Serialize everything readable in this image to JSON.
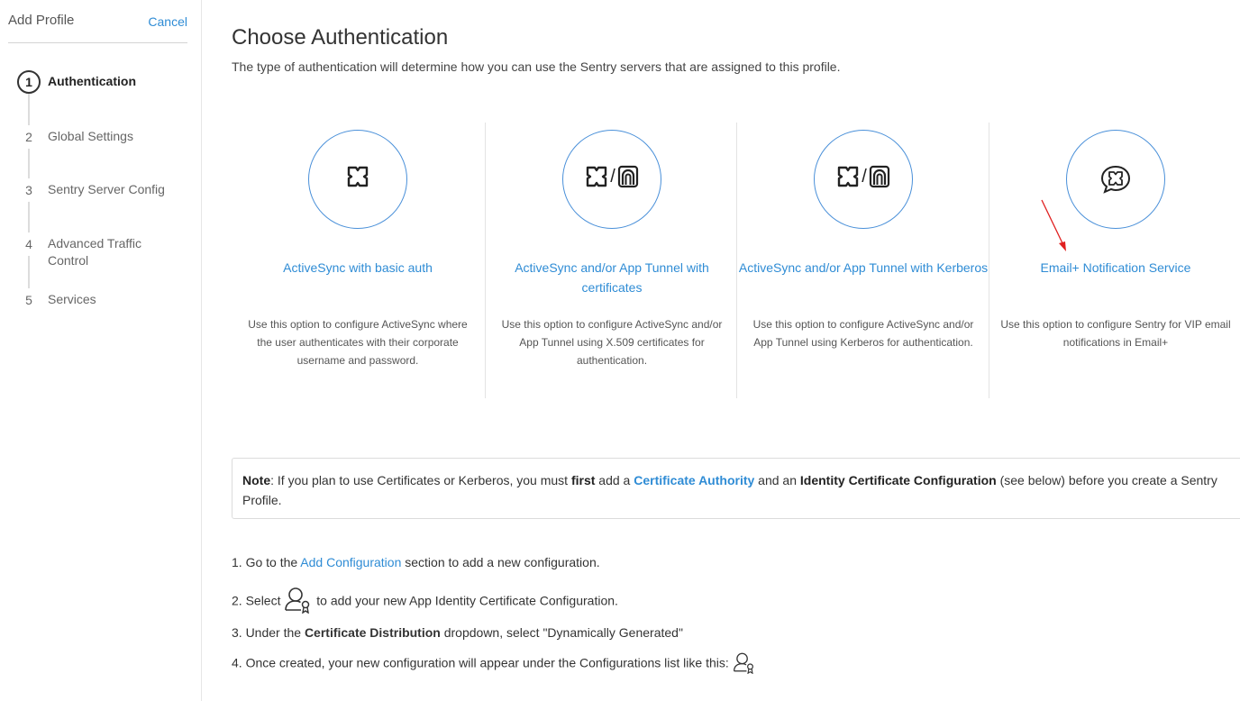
{
  "sidebar": {
    "title": "Add Profile",
    "cancel_label": "Cancel",
    "steps": [
      {
        "number": "1",
        "label": "Authentication",
        "active": true
      },
      {
        "number": "2",
        "label": "Global Settings",
        "active": false
      },
      {
        "number": "3",
        "label": "Sentry Server Config",
        "active": false
      },
      {
        "number": "4",
        "label": "Advanced Traffic\nControl",
        "active": false
      },
      {
        "number": "5",
        "label": "Services",
        "active": false
      }
    ]
  },
  "main": {
    "title": "Choose Authentication",
    "subtitle": "The type of authentication will determine how you can use the Sentry servers that are assigned to this profile.",
    "options": [
      {
        "icon": "activesync-icon",
        "title": "ActiveSync with basic auth",
        "description": "Use this option to configure ActiveSync where the user authenticates with their corporate username and password."
      },
      {
        "icon": "activesync-apptunnel-icon",
        "title": "ActiveSync and/or App Tunnel with certificates",
        "description": "Use this option to configure ActiveSync and/or App Tunnel using X.509 certificates for authentication."
      },
      {
        "icon": "activesync-apptunnel-icon",
        "title": "ActiveSync and/or App Tunnel with Kerberos",
        "description": "Use this option to configure ActiveSync and/or App Tunnel using Kerberos for authentication."
      },
      {
        "icon": "email-plus-icon",
        "title": "Email+ Notification Service",
        "description": "Use this option to configure Sentry for VIP email notifications in Email+"
      }
    ],
    "note": {
      "label": "Note",
      "text_1": ": If you plan to use Certificates or Kerberos, you must ",
      "first": "first",
      "text_2": " add a ",
      "ca_link": "Certificate Authority",
      "text_3": " and an ",
      "ic_config": "Identity Certificate Configuration",
      "text_4": " (see below) before you create a Sentry Profile."
    },
    "instructions": {
      "s1_prefix": "1. Go to the ",
      "s1_link": "Add Configuration",
      "s1_suffix": " section to add a new configuration.",
      "s2_prefix": "2. Select ",
      "s2_suffix": " to add your new App Identity Certificate Configuration.",
      "s3_prefix": "3. Under the ",
      "s3_bold": "Certificate Distribution",
      "s3_suffix": " dropdown, select \"Dynamically Generated\"",
      "s4_text": "4. Once created, your new configuration will appear under the Configurations list like this: "
    }
  },
  "colors": {
    "accent": "#2f8cd5",
    "circle_border": "#4a90d9",
    "annotation_arrow": "#e02020"
  }
}
